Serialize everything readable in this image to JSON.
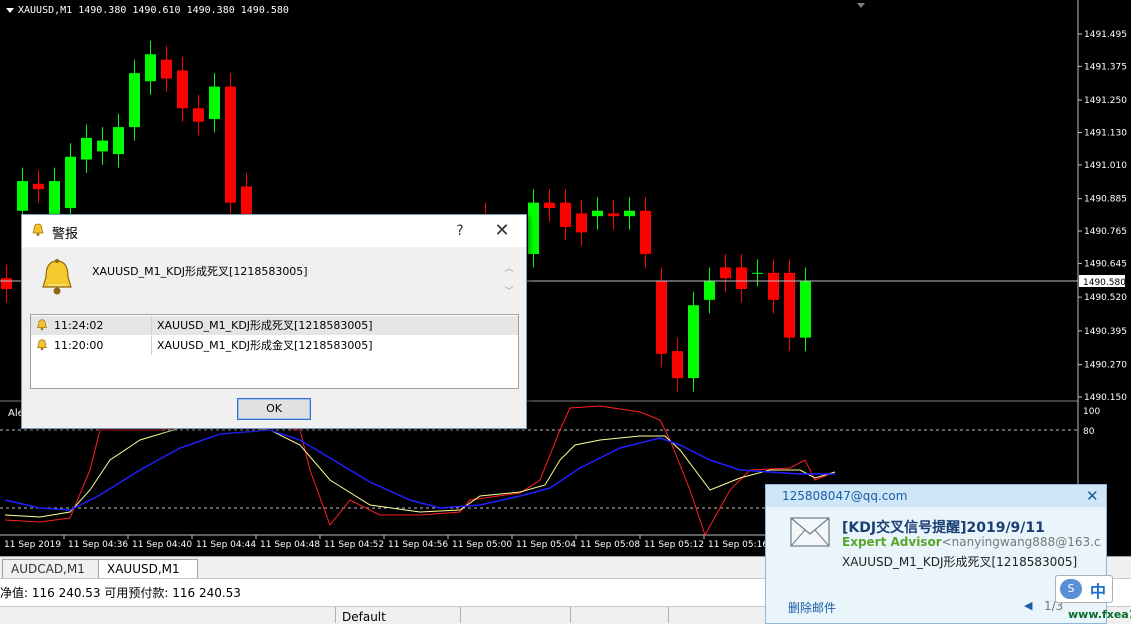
{
  "chart": {
    "symbol_header": "XAUUSD,M1  1490.380 1490.610 1490.380 1490.580",
    "current_price_label": "1490.580",
    "price_axis": [
      "1491.495",
      "1491.375",
      "1491.250",
      "1491.130",
      "1491.010",
      "1490.885",
      "1490.765",
      "1490.645",
      "1490.520",
      "1490.395",
      "1490.270",
      "1490.150"
    ],
    "indicator_axis": [
      "100",
      "80"
    ],
    "time_axis": [
      "11 Sep 2019",
      "11 Sep 04:36",
      "11 Sep 04:40",
      "11 Sep 04:44",
      "11 Sep 04:48",
      "11 Sep 04:52",
      "11 Sep 04:56",
      "11 Sep 05:00",
      "11 Sep 05:04",
      "11 Sep 05:08",
      "11 Sep 05:12",
      "11 Sep 05:16"
    ],
    "indicator_partial_label": "Ale",
    "colors": {
      "bull": "#00ff00",
      "bear": "#ff0000",
      "k_line": "#ffff99",
      "d_line": "#2020ff",
      "j_line": "#ff2020"
    },
    "candles": [
      {
        "o": 1490.59,
        "c": 1490.55
      },
      {
        "o": 1490.84,
        "c": 1490.95
      },
      {
        "o": 1490.94,
        "c": 1490.92
      },
      {
        "o": 1490.82,
        "c": 1490.95
      },
      {
        "o": 1490.85,
        "c": 1491.04
      },
      {
        "o": 1491.03,
        "c": 1491.11
      },
      {
        "o": 1491.06,
        "c": 1491.1
      },
      {
        "o": 1491.05,
        "c": 1491.15
      },
      {
        "o": 1491.15,
        "c": 1491.35
      },
      {
        "o": 1491.32,
        "c": 1491.42
      },
      {
        "o": 1491.4,
        "c": 1491.33
      },
      {
        "o": 1491.36,
        "c": 1491.22
      },
      {
        "o": 1491.22,
        "c": 1491.17
      },
      {
        "o": 1491.18,
        "c": 1491.3
      },
      {
        "o": 1491.3,
        "c": 1490.87
      },
      {
        "o": 1490.93,
        "c": 1490.81
      }
    ],
    "candles_right": [
      {
        "o": 1490.82,
        "c": 1490.81
      },
      {
        "o": 1490.53,
        "c": 1490.66
      },
      {
        "o": 1490.56,
        "c": 1490.68
      },
      {
        "o": 1490.68,
        "c": 1490.87
      },
      {
        "o": 1490.87,
        "c": 1490.85
      },
      {
        "o": 1490.87,
        "c": 1490.78
      },
      {
        "o": 1490.83,
        "c": 1490.76
      },
      {
        "o": 1490.82,
        "c": 1490.84
      },
      {
        "o": 1490.83,
        "c": 1490.82
      },
      {
        "o": 1490.82,
        "c": 1490.84
      },
      {
        "o": 1490.84,
        "c": 1490.68
      },
      {
        "o": 1490.58,
        "c": 1490.31
      },
      {
        "o": 1490.32,
        "c": 1490.22
      },
      {
        "o": 1490.22,
        "c": 1490.49
      },
      {
        "o": 1490.51,
        "c": 1490.58
      },
      {
        "o": 1490.63,
        "c": 1490.59
      },
      {
        "o": 1490.63,
        "c": 1490.55
      },
      {
        "o": 1490.61,
        "c": 1490.61
      },
      {
        "o": 1490.61,
        "c": 1490.51
      },
      {
        "o": 1490.61,
        "c": 1490.37
      },
      {
        "o": 1490.37,
        "c": 1490.58
      }
    ]
  },
  "tabs": [
    {
      "label": "AUDCAD,M1"
    },
    {
      "label": "XAUUSD,M1"
    }
  ],
  "status": {
    "text": "净值: 116 240.53   可用预付款: 116 240.53"
  },
  "bottom_bar": {
    "profile": "Default"
  },
  "alert": {
    "title": "警报",
    "help": "?",
    "close": "✕",
    "message": "XAUUSD_M1_KDJ形成死叉[1218583005]",
    "rows": [
      {
        "time": "11:24:02",
        "message": "XAUUSD_M1_KDJ形成死叉[1218583005]"
      },
      {
        "time": "11:20:00",
        "message": "XAUUSD_M1_KDJ形成金叉[1218583005]"
      }
    ],
    "ok_label": "OK"
  },
  "mail": {
    "account": "125808047@qq.com",
    "close": "✕",
    "subject": "[KDJ交叉信号提醒]2019/9/11",
    "sender_name": "Expert Advisor",
    "sender_addr": "<nanyingwang888@163.c...",
    "preview": "XAUUSD_M1_KDJ形成死叉[1218583005]",
    "delete_label": "删除邮件",
    "page": "1/3"
  },
  "ime": {
    "lang": "中"
  },
  "watermark": "www.fxea168.com"
}
